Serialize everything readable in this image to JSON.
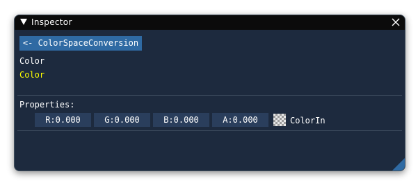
{
  "window": {
    "title": "Inspector"
  },
  "back_button": {
    "label": "<- ColorSpaceConversion"
  },
  "node": {
    "type_label": "Color",
    "name_link": "Color"
  },
  "properties": {
    "heading": "Properties:",
    "fields": {
      "r": "R:0.000",
      "g": "G:0.000",
      "b": "B:0.000",
      "a": "A:0.000"
    },
    "swatch_label": "ColorIn"
  },
  "icons": {
    "collapse": "triangle-down-icon",
    "close": "close-icon",
    "resize": "resize-grip-icon"
  },
  "colors": {
    "window_bg": "#1d2a3e",
    "titlebar_bg": "#0b0b0b",
    "button_bg": "#2f6aa3",
    "field_bg": "#2a3e5c",
    "link_text": "#ffff00"
  }
}
